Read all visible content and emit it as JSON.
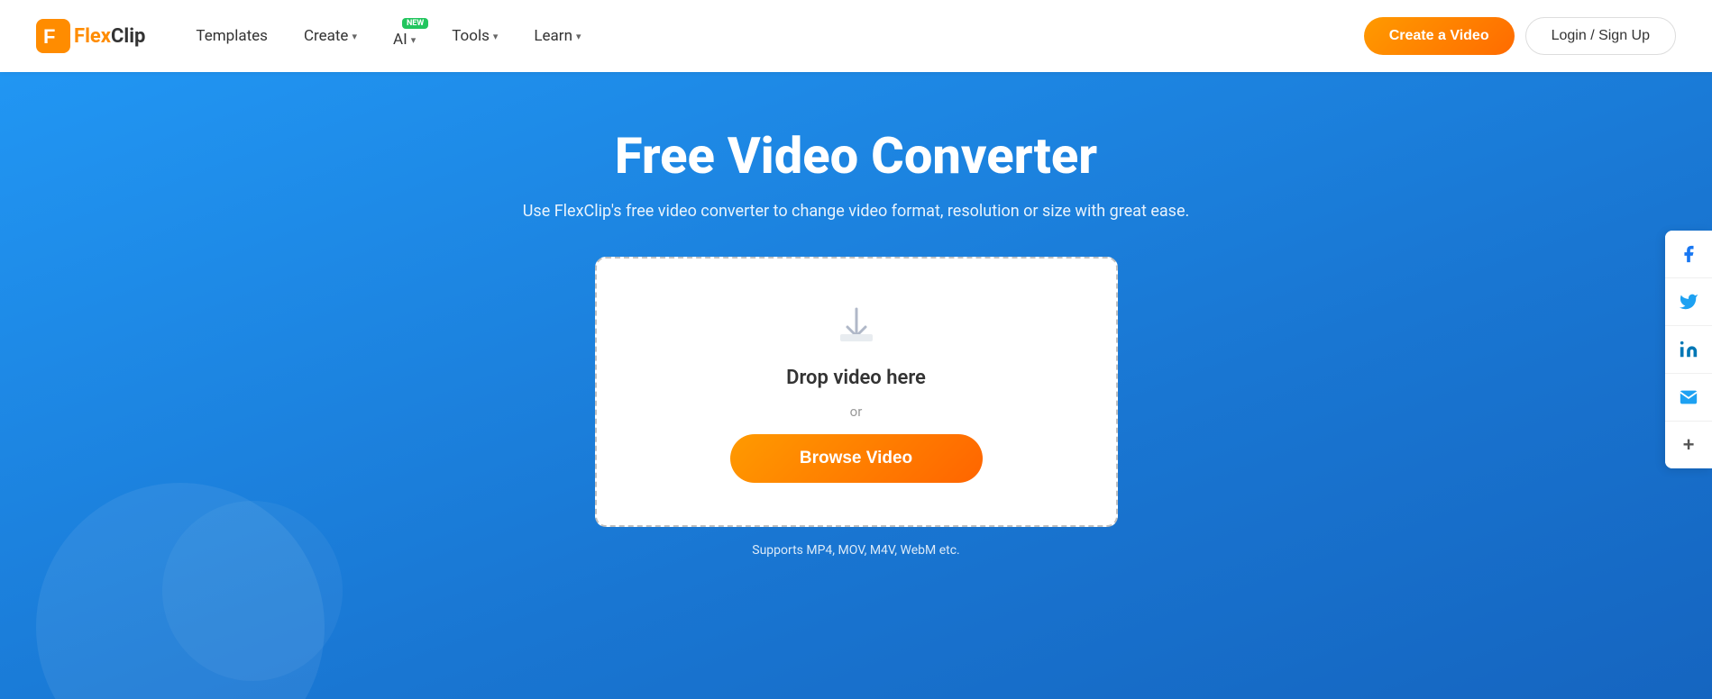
{
  "brand": {
    "name_flex": "Flex",
    "name_clip": "Clip"
  },
  "navbar": {
    "templates_label": "Templates",
    "create_label": "Create",
    "ai_label": "AI",
    "ai_badge": "NEW",
    "tools_label": "Tools",
    "learn_label": "Learn",
    "create_video_btn": "Create a Video",
    "login_btn": "Login / Sign Up"
  },
  "hero": {
    "title": "Free Video Converter",
    "subtitle": "Use FlexClip's free video converter to change video format, resolution or size with great ease.",
    "drop_text": "Drop video here",
    "or_text": "or",
    "browse_btn": "Browse Video",
    "supports_text": "Supports MP4, MOV, M4V, WebM etc."
  },
  "social": {
    "facebook_label": "facebook",
    "twitter_label": "twitter",
    "linkedin_label": "linkedin",
    "email_label": "email",
    "more_label": "more"
  }
}
